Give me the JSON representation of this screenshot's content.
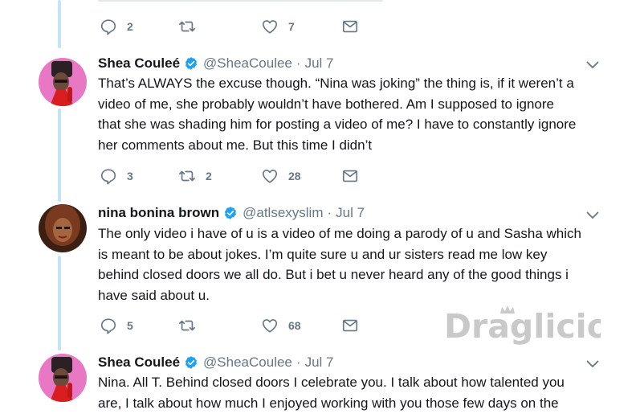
{
  "colors": {
    "thread_line": "#c4e4f6",
    "verified": "#1da1f2",
    "secondary_text": "#657786",
    "icon": "#657786",
    "watermark": "#c9c9c9"
  },
  "top_tweet": {
    "text_fragment": "",
    "reply_count": "2",
    "retweet_count": "",
    "like_count": "7"
  },
  "tweets": [
    {
      "name": "Shea Couleé",
      "handle": "@SheaCoulee",
      "separator": "·",
      "date": "Jul 7",
      "lines": [
        "That’s ALWAYS the excuse though. “Nina was joking” the thing is, if it weren’t a",
        "video of me, she probably wouldn’t have bothered. Am I supposed to ignore",
        "that she was shading him for posting a video of me? I have to constantly ignore",
        "her comments about me. But this time I didn’t"
      ],
      "reply_count": "3",
      "retweet_count": "2",
      "like_count": "28"
    },
    {
      "name": "nina bonina brown",
      "handle": "@atlsexyslim",
      "separator": "·",
      "date": "Jul 7",
      "lines": [
        "The only video i have of u is a video of me doing a parody of u and Sasha which",
        "is meant to be about jokes. I’m quite sure u and ur sisters read me low key",
        "behind closed doors we all do. But i bet u never heard any of the good things i",
        "have said about u."
      ],
      "reply_count": "5",
      "retweet_count": "",
      "like_count": "68"
    },
    {
      "name": "Shea Couleé",
      "handle": "@SheaCoulee",
      "separator": "·",
      "date": "Jul 7",
      "lines": [
        "Nina. All T. Behind closed doors I celebrate you. I talk about how talented you",
        "are, I talk about how much I enjoyed working with you those few days on the"
      ]
    }
  ],
  "watermark": {
    "text": "Draglicious",
    "icon": "crown-icon"
  },
  "icons": {
    "reply": "reply-icon",
    "retweet": "retweet-icon",
    "like": "heart-icon",
    "message": "envelope-icon",
    "verified": "verified-badge-icon",
    "caret": "chevron-down-icon"
  }
}
